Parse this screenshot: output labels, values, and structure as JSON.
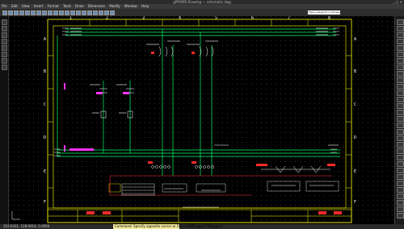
{
  "window": {
    "title": "gPROMS Drawing — schematic.dwg",
    "controls": "_ □ ×"
  },
  "menu": [
    "File",
    "Edit",
    "View",
    "Insert",
    "Format",
    "Tools",
    "Draw",
    "Dimension",
    "Modify",
    "Window",
    "Help"
  ],
  "toolbar": {
    "search_placeholder": "Type a keyword or phrase"
  },
  "drawing": {
    "row_labels": [
      "A",
      "B",
      "C",
      "D",
      "E",
      "F"
    ],
    "col_labels": [
      "1",
      "2",
      "3",
      "4",
      "5",
      "6",
      "7",
      "8"
    ],
    "colors": {
      "background": "#000000",
      "wire": "#00ff66",
      "frame": "#ffff00",
      "text": "#ffffff",
      "red": "#ff2a2a",
      "magenta": "#ff33ff",
      "grid": "#2e2e2e"
    }
  },
  "status": {
    "coords": "352.6431, 128.0914, 0.0000",
    "command": "Command: Specify opposite corner or [Fence/WPolygon/CPolygon]:"
  }
}
